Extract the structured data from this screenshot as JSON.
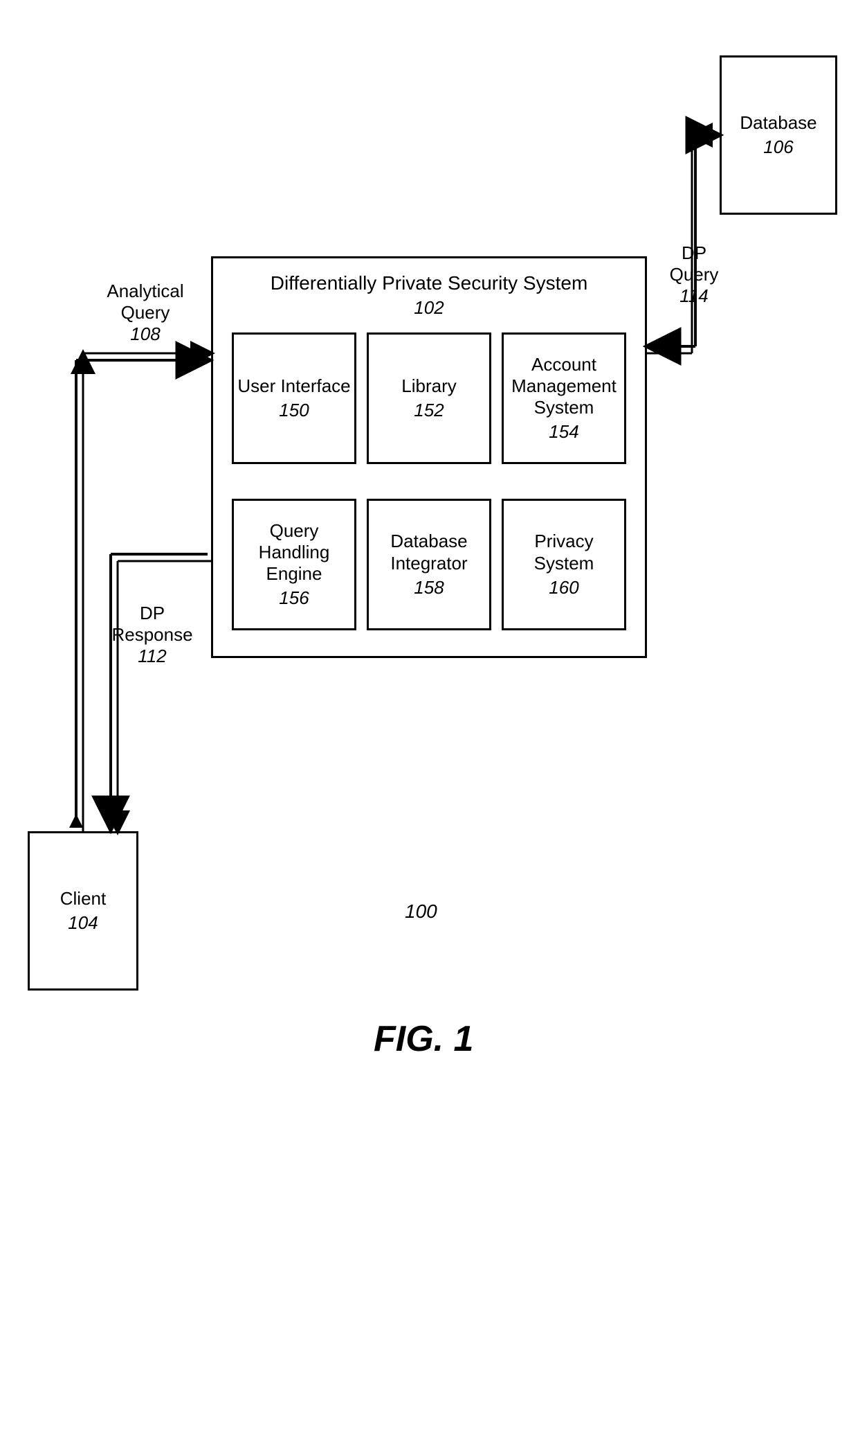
{
  "figure": {
    "number": "100",
    "label": "FIG. 1"
  },
  "system": {
    "title": "Differentially Private Security System",
    "ref": "102",
    "modules": {
      "ui": {
        "title": "User Interface",
        "ref": "150"
      },
      "library": {
        "title": "Library",
        "ref": "152"
      },
      "account": {
        "title": "Account Management System",
        "ref": "154"
      },
      "qhe": {
        "title": "Query Handling Engine",
        "ref": "156"
      },
      "dbint": {
        "title": "Database Integrator",
        "ref": "158"
      },
      "privacy": {
        "title": "Privacy System",
        "ref": "160"
      }
    }
  },
  "client": {
    "title": "Client",
    "ref": "104"
  },
  "database": {
    "title": "Database",
    "ref": "106"
  },
  "flows": {
    "analytical_query": {
      "label": "Analytical Query",
      "ref": "108"
    },
    "dp_response": {
      "label": "DP Response",
      "ref": "112"
    },
    "dp_query": {
      "label": "DP Query",
      "ref": "114"
    }
  }
}
